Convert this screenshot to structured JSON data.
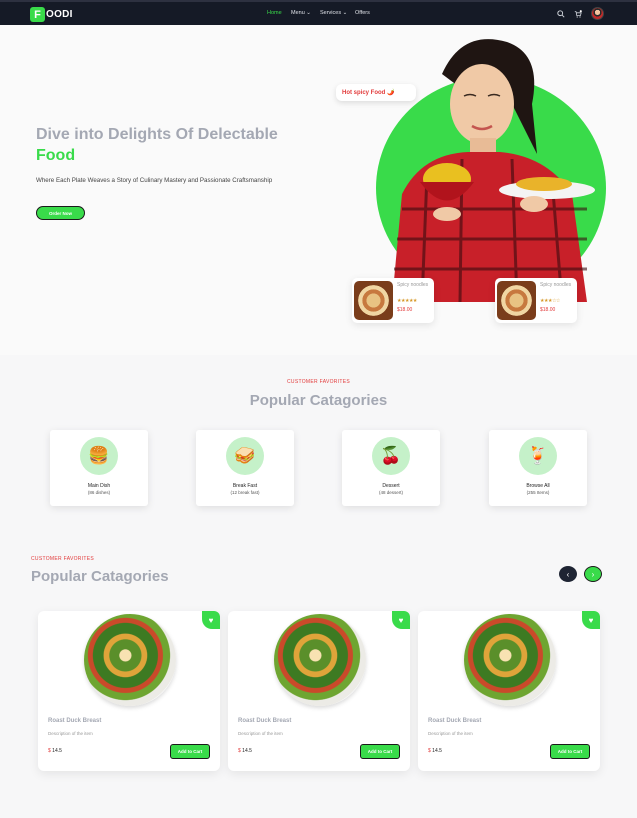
{
  "header": {
    "logo_letter": "F",
    "logo_rest": "OODI",
    "nav": [
      {
        "label": "Home"
      },
      {
        "label": "Menu ⌄"
      },
      {
        "label": "Services ⌄"
      },
      {
        "label": "Offers"
      }
    ],
    "icons": [
      "search-icon",
      "cart-icon",
      "avatar"
    ]
  },
  "hero": {
    "title_line1": "Dive into Delights Of Delectable",
    "title_line2": "Food",
    "subtitle": "Where Each Plate Weaves a Story of Culinary Mastery and Passionate Craftsmanship",
    "cta_label": "Order Now",
    "hot_tag": "Hot spicy Food 🌶️",
    "mini_cards": [
      {
        "name": "Spicy noodles",
        "stars": "★★★★★",
        "price": "$18.00"
      },
      {
        "name": "Spicy noodles",
        "stars": "★★★☆☆",
        "price": "$18.00"
      }
    ]
  },
  "categories": {
    "eyebrow": "CUSTOMER FAVORITES",
    "heading": "Popular Catagories",
    "items": [
      {
        "emoji": "🍔",
        "name": "Main Dish",
        "count": "(86 dishes)"
      },
      {
        "emoji": "🥪",
        "name": "Break Fast",
        "count": "(12 break fast)"
      },
      {
        "emoji": "🍒",
        "name": "Dessert",
        "count": "(48 dessert)"
      },
      {
        "emoji": "🍹",
        "name": "Browse All",
        "count": "(255 Items)"
      }
    ]
  },
  "specials": {
    "eyebrow": "CUSTOMER FAVORITES",
    "heading": "Popular Catagories",
    "prev": "‹",
    "next": "›",
    "items": [
      {
        "name": "Roast Duck Breast",
        "desc": "Description of the item",
        "currency": "$",
        "price": "14.5",
        "button": "Add to Cart"
      },
      {
        "name": "Roast Duck Breast",
        "desc": "Description of the item",
        "currency": "$",
        "price": "14.5",
        "button": "Add to Cart"
      },
      {
        "name": "Roast Duck Breast",
        "desc": "Description of the item",
        "currency": "$",
        "price": "14.5",
        "button": "Add to Cart"
      }
    ]
  },
  "colors": {
    "accent": "#39db4a",
    "header_bg": "#151a26",
    "heading_gray": "#a4a8b3",
    "price_red": "#e23b3b"
  }
}
